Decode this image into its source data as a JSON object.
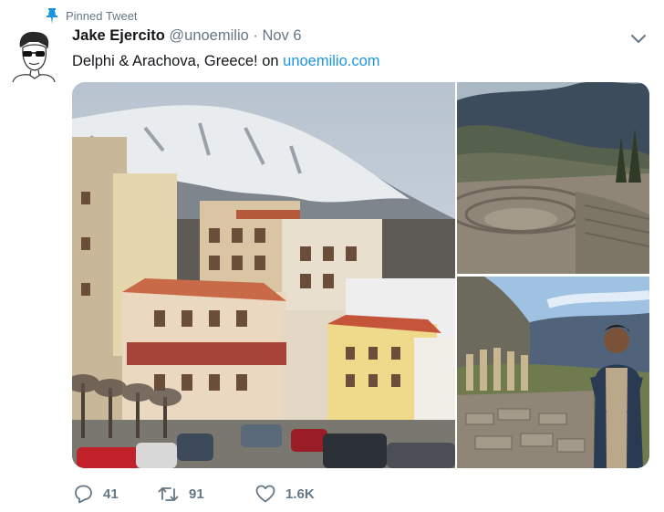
{
  "pinned": {
    "label": "Pinned Tweet",
    "icon": "pin-icon"
  },
  "tweet": {
    "author_name": "Jake Ejercito",
    "handle": "@unoemilio",
    "separator": "·",
    "time": "Nov 6",
    "text": "Delphi & Arachova, Greece! on ",
    "link": "unoemilio.com",
    "menu_icon": "chevron-down-icon"
  },
  "actions": {
    "replies": "41",
    "retweets": "91",
    "likes": "1.6K"
  },
  "colors": {
    "link": "#1b95e0",
    "pin": "#1b95e0",
    "muted": "#657786"
  }
}
